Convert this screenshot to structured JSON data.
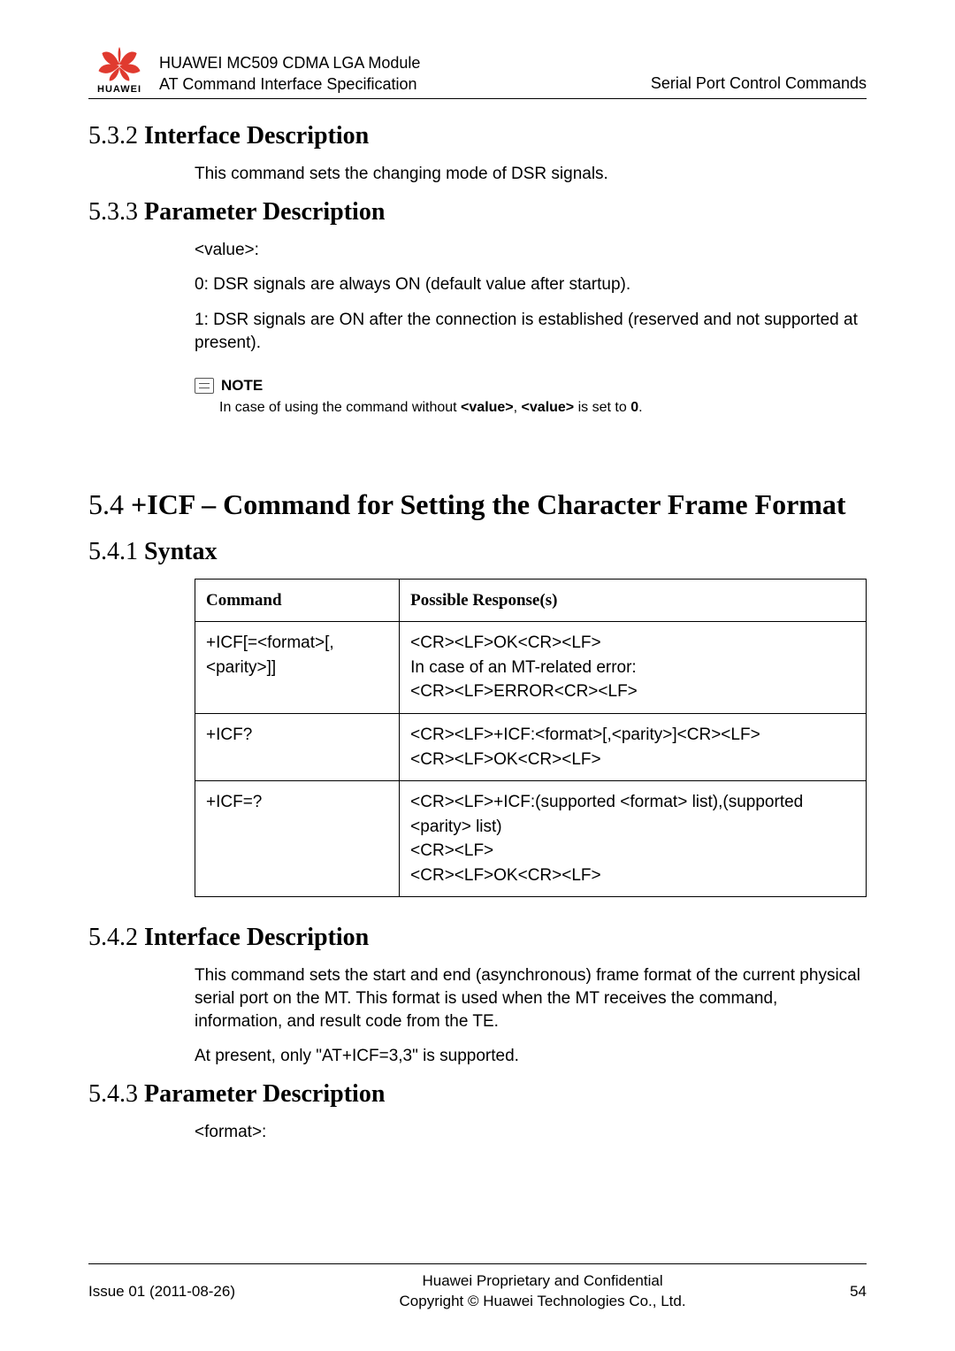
{
  "header": {
    "logo_text": "HUAWEI",
    "title_line1": "HUAWEI MC509 CDMA LGA Module",
    "title_line2": "AT Command Interface Specification",
    "right": "Serial Port Control Commands"
  },
  "sec_5_3_2": {
    "num": "5.3.2 ",
    "title": "Interface Description",
    "body": "This command sets the changing mode of DSR signals."
  },
  "sec_5_3_3": {
    "num": "5.3.3 ",
    "title": "Parameter Description",
    "p1": "<value>:",
    "p2": "0: DSR signals are always ON (default value after startup).",
    "p3": "1: DSR signals are ON after the connection is established (reserved and not supported at present)."
  },
  "note": {
    "label": "NOTE",
    "text_pre": "In case of using the command without ",
    "v1": "<value>",
    "mid": ", ",
    "v2": "<value>",
    "post": " is set to ",
    "zero": "0",
    "dot": "."
  },
  "sec_5_4": {
    "num": "5.4 ",
    "title": "+ICF – Command for Setting the Character Frame Format"
  },
  "sec_5_4_1": {
    "num": "5.4.1 ",
    "title": "Syntax"
  },
  "table": {
    "h1": "Command",
    "h2": "Possible Response(s)",
    "rows": [
      {
        "cmd": "+ICF[=<format>[,<parity>]]",
        "resp": "<CR><LF>OK<CR><LF>\nIn case of an MT-related error:\n<CR><LF>ERROR<CR><LF>"
      },
      {
        "cmd": "+ICF?",
        "resp": "<CR><LF>+ICF:<format>[,<parity>]<CR><LF>\n<CR><LF>OK<CR><LF>"
      },
      {
        "cmd": "+ICF=?",
        "resp": "<CR><LF>+ICF:(supported <format> list),(supported <parity> list)\n<CR><LF>\n<CR><LF>OK<CR><LF>"
      }
    ]
  },
  "sec_5_4_2": {
    "num": "5.4.2 ",
    "title": "Interface Description",
    "p1": "This command sets the start and end (asynchronous) frame format of the current physical serial port on the MT. This format is used when the MT receives the command, information, and result code from the TE.",
    "p2": "At present, only \"AT+ICF=3,3\" is supported."
  },
  "sec_5_4_3": {
    "num": "5.4.3 ",
    "title": "Parameter Description",
    "p1": "<format>:"
  },
  "footer": {
    "left": "Issue 01 (2011-08-26)",
    "c1": "Huawei Proprietary and Confidential",
    "c2": "Copyright © Huawei Technologies Co., Ltd.",
    "right": "54"
  }
}
